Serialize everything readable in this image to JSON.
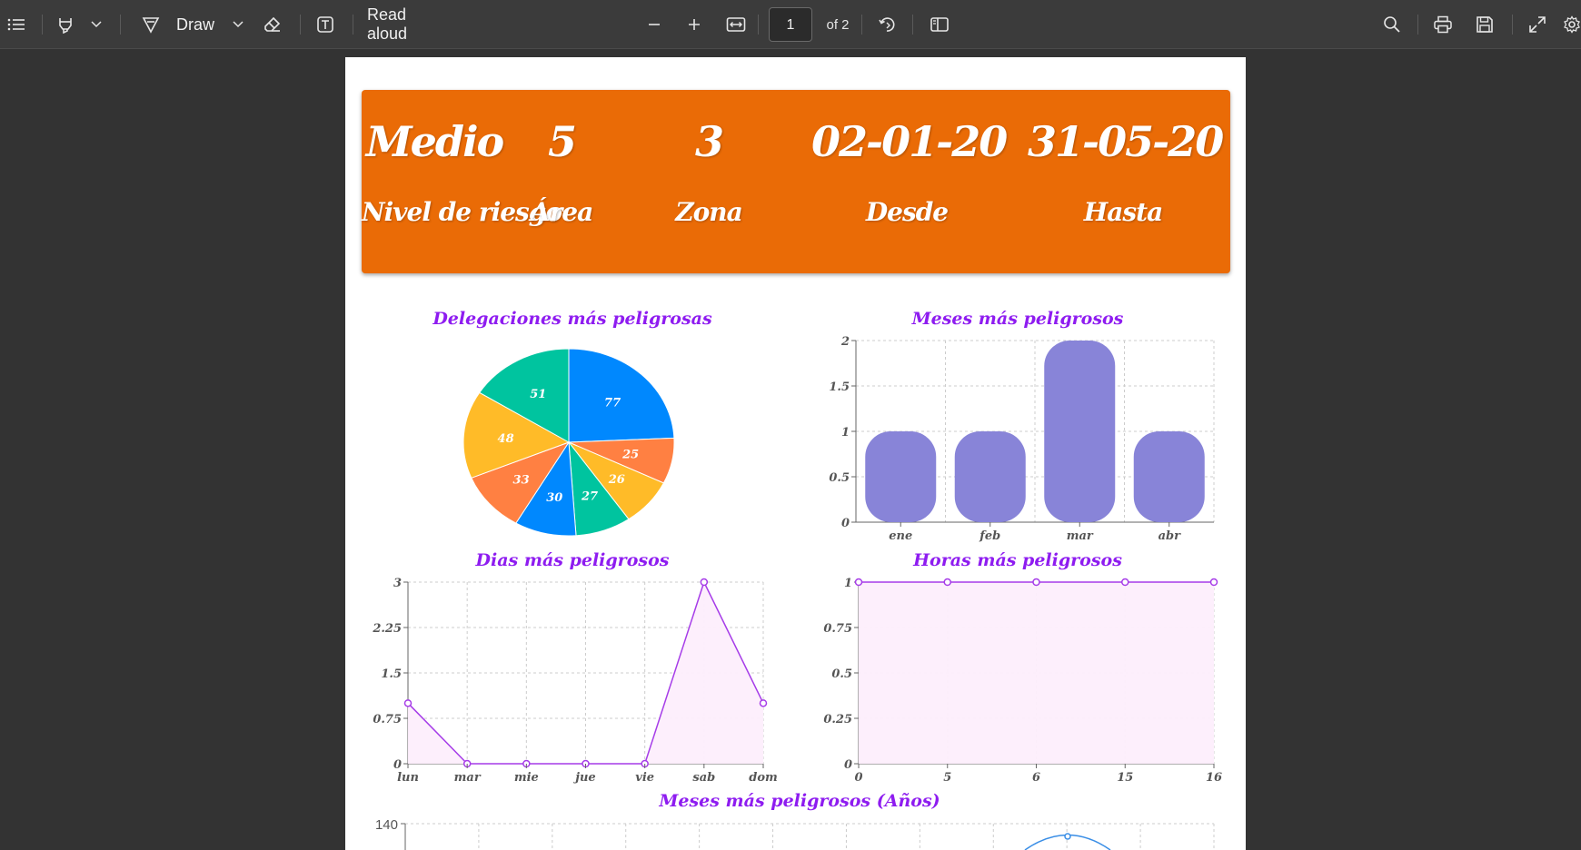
{
  "toolbar": {
    "draw_label": "Draw",
    "read_aloud_label": "Read aloud",
    "page_current": "1",
    "page_total": "of 2"
  },
  "banner": {
    "items": [
      {
        "value": "Medio",
        "label": "Nivel de riesgo"
      },
      {
        "value": "5",
        "label": "Área"
      },
      {
        "value": "3",
        "label": "Zona"
      },
      {
        "value": "02-01-20",
        "label": "Desde"
      },
      {
        "value": "31-05-20",
        "label": "Hasta"
      }
    ]
  },
  "colors": {
    "banner": "#ea6b06",
    "title": "#8e1cf0",
    "bar": "#8884d8",
    "line": "#a63ce8",
    "area_fill": "#fdeefc"
  },
  "chart_data": [
    {
      "type": "pie",
      "title": "Delegaciones más peligrosas",
      "values": [
        77,
        25,
        26,
        27,
        30,
        33,
        48,
        51
      ],
      "colors": [
        "#0088fe",
        "#ff8042",
        "#ffbb28",
        "#00c49f",
        "#0088fe",
        "#ff8042",
        "#ffbb28",
        "#00c49f"
      ]
    },
    {
      "type": "bar",
      "title": "Meses más peligrosos",
      "categories": [
        "ene",
        "feb",
        "mar",
        "abr"
      ],
      "values": [
        1,
        1,
        2,
        1
      ],
      "yticks": [
        "0",
        "0.5",
        "1",
        "1.5",
        "2"
      ],
      "ylim": [
        0,
        2
      ],
      "grid": true
    },
    {
      "type": "area",
      "title": "Dias más peligrosos",
      "categories": [
        "lun",
        "mar",
        "mie",
        "jue",
        "vie",
        "sab",
        "dom"
      ],
      "values": [
        1,
        0,
        0,
        0,
        0,
        3,
        1
      ],
      "yticks": [
        "0",
        "0.75",
        "1.5",
        "2.25",
        "3"
      ],
      "ylim": [
        0,
        3
      ],
      "grid": true
    },
    {
      "type": "area",
      "title": "Horas más peligrosos",
      "categories": [
        "0",
        "5",
        "6",
        "15",
        "16"
      ],
      "values": [
        1,
        1,
        1,
        1,
        1
      ],
      "yticks": [
        "0",
        "0.25",
        "0.5",
        "0.75",
        "1"
      ],
      "ylim": [
        0,
        1
      ],
      "grid": true
    },
    {
      "type": "line",
      "title": "Meses más peligrosos (Años)",
      "yticks": [
        "140"
      ],
      "grid": true
    }
  ]
}
